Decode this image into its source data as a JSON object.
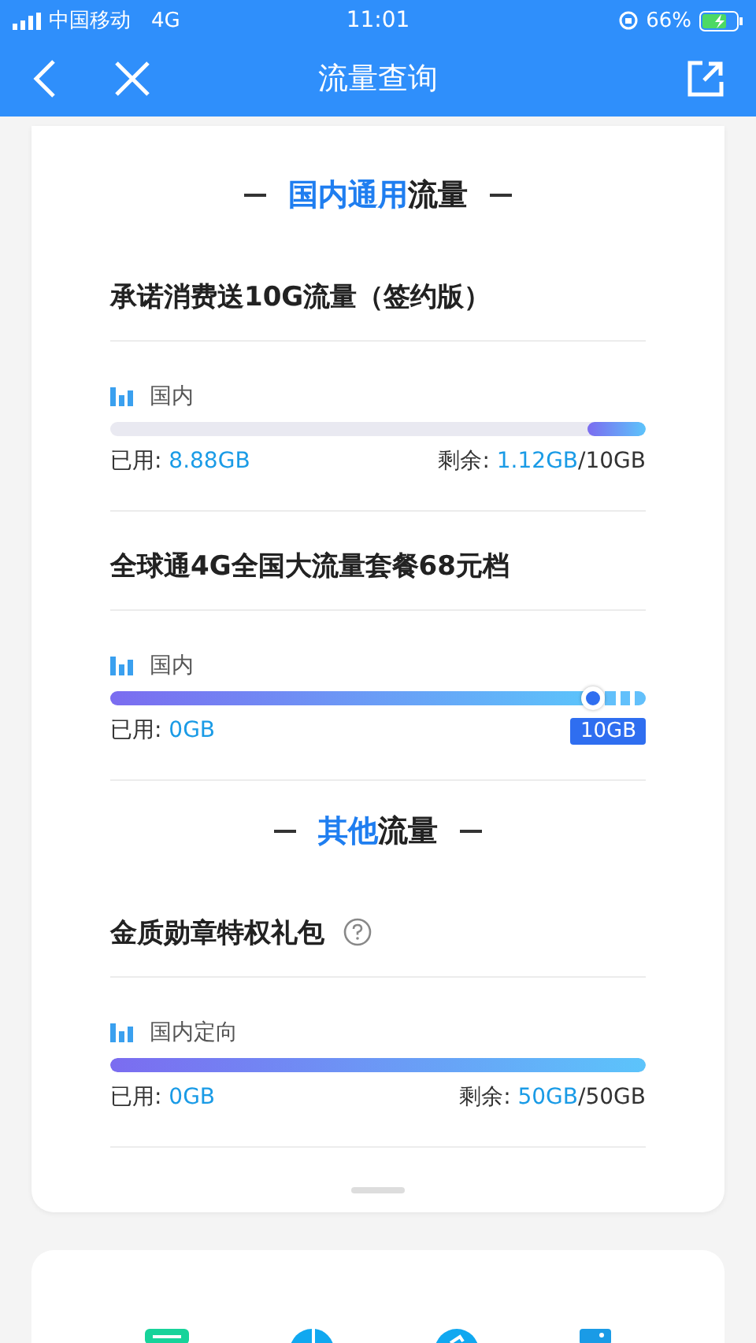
{
  "status_bar": {
    "carrier": "中国移动",
    "network": "4G",
    "time": "11:01",
    "battery": "66%"
  },
  "nav": {
    "title": "流量查询"
  },
  "sections": [
    {
      "highlight": "国内通用",
      "rest": "流量",
      "plans": [
        {
          "title": "承诺消费送10G流量（签约版）",
          "help": false,
          "quota": {
            "kind": "remaining",
            "label": "国内",
            "level": 0.11,
            "used_label": "已用:",
            "used": "8.88GB",
            "remain_label": "剩余:",
            "remain": "1.12GB",
            "total": "/10GB"
          }
        },
        {
          "title": "全球通4G全国大流量套餐68元档",
          "help": false,
          "quota": {
            "kind": "capped",
            "label": "国内",
            "level": 0.9,
            "used_label": "已用:",
            "used": "0GB",
            "badge": "10GB"
          }
        }
      ]
    },
    {
      "highlight": "其他",
      "rest": "流量",
      "plans": [
        {
          "title": "金质勋章特权礼包",
          "help": true,
          "quota": {
            "kind": "remaining",
            "label": "国内定向",
            "level": 1,
            "used_label": "已用:",
            "used": "0GB",
            "remain_label": "剩余:",
            "remain": "50GB",
            "total": "/50GB"
          }
        }
      ]
    }
  ]
}
